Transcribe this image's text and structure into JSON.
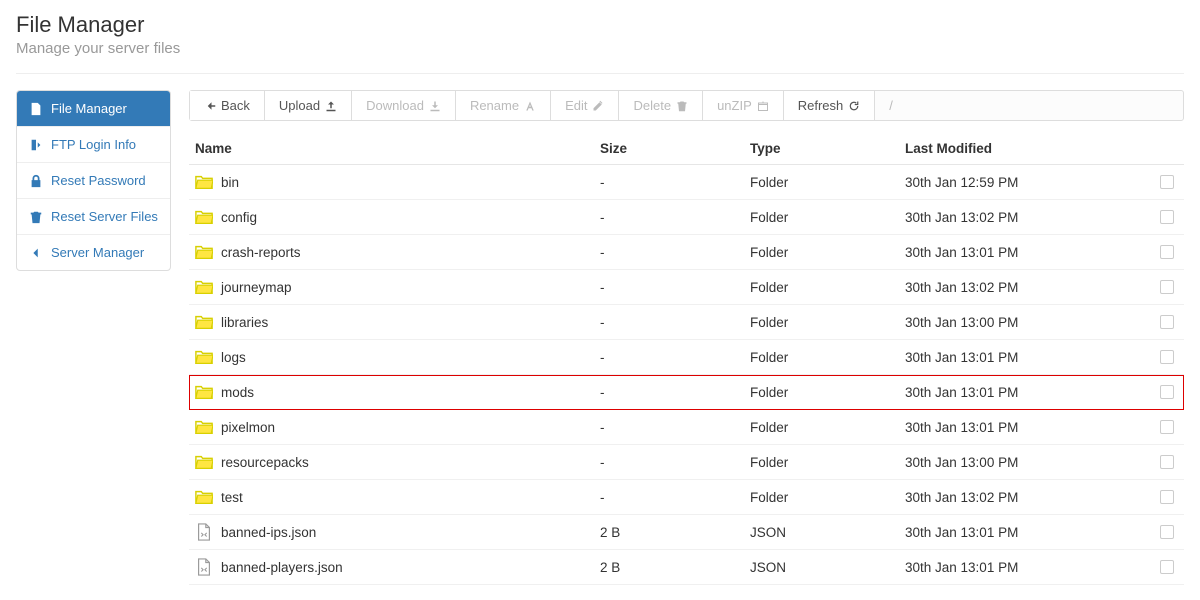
{
  "header": {
    "title": "File Manager",
    "subtitle": "Manage your server files"
  },
  "sidebar": {
    "items": [
      {
        "label": "File Manager",
        "icon": "file-icon",
        "active": true
      },
      {
        "label": "FTP Login Info",
        "icon": "login-icon",
        "active": false
      },
      {
        "label": "Reset Password",
        "icon": "lock-icon",
        "active": false
      },
      {
        "label": "Reset Server Files",
        "icon": "trash-icon",
        "active": false
      },
      {
        "label": "Server Manager",
        "icon": "chevron-left-icon",
        "active": false
      }
    ]
  },
  "toolbar": {
    "back": "Back",
    "upload": "Upload",
    "download": "Download",
    "rename": "Rename",
    "edit": "Edit",
    "delete": "Delete",
    "unzip": "unZIP",
    "refresh": "Refresh",
    "breadcrumb": "/"
  },
  "table": {
    "headers": {
      "name": "Name",
      "size": "Size",
      "type": "Type",
      "modified": "Last Modified"
    },
    "rows": [
      {
        "name": "bin",
        "size": "-",
        "type": "Folder",
        "modified": "30th Jan 12:59 PM",
        "kind": "folder",
        "highlight": false
      },
      {
        "name": "config",
        "size": "-",
        "type": "Folder",
        "modified": "30th Jan 13:02 PM",
        "kind": "folder",
        "highlight": false
      },
      {
        "name": "crash-reports",
        "size": "-",
        "type": "Folder",
        "modified": "30th Jan 13:01 PM",
        "kind": "folder",
        "highlight": false
      },
      {
        "name": "journeymap",
        "size": "-",
        "type": "Folder",
        "modified": "30th Jan 13:02 PM",
        "kind": "folder",
        "highlight": false
      },
      {
        "name": "libraries",
        "size": "-",
        "type": "Folder",
        "modified": "30th Jan 13:00 PM",
        "kind": "folder",
        "highlight": false
      },
      {
        "name": "logs",
        "size": "-",
        "type": "Folder",
        "modified": "30th Jan 13:01 PM",
        "kind": "folder",
        "highlight": false
      },
      {
        "name": "mods",
        "size": "-",
        "type": "Folder",
        "modified": "30th Jan 13:01 PM",
        "kind": "folder",
        "highlight": true
      },
      {
        "name": "pixelmon",
        "size": "-",
        "type": "Folder",
        "modified": "30th Jan 13:01 PM",
        "kind": "folder",
        "highlight": false
      },
      {
        "name": "resourcepacks",
        "size": "-",
        "type": "Folder",
        "modified": "30th Jan 13:00 PM",
        "kind": "folder",
        "highlight": false
      },
      {
        "name": "test",
        "size": "-",
        "type": "Folder",
        "modified": "30th Jan 13:02 PM",
        "kind": "folder",
        "highlight": false
      },
      {
        "name": "banned-ips.json",
        "size": "2 B",
        "type": "JSON",
        "modified": "30th Jan 13:01 PM",
        "kind": "file",
        "highlight": false
      },
      {
        "name": "banned-players.json",
        "size": "2 B",
        "type": "JSON",
        "modified": "30th Jan 13:01 PM",
        "kind": "file",
        "highlight": false
      }
    ]
  }
}
